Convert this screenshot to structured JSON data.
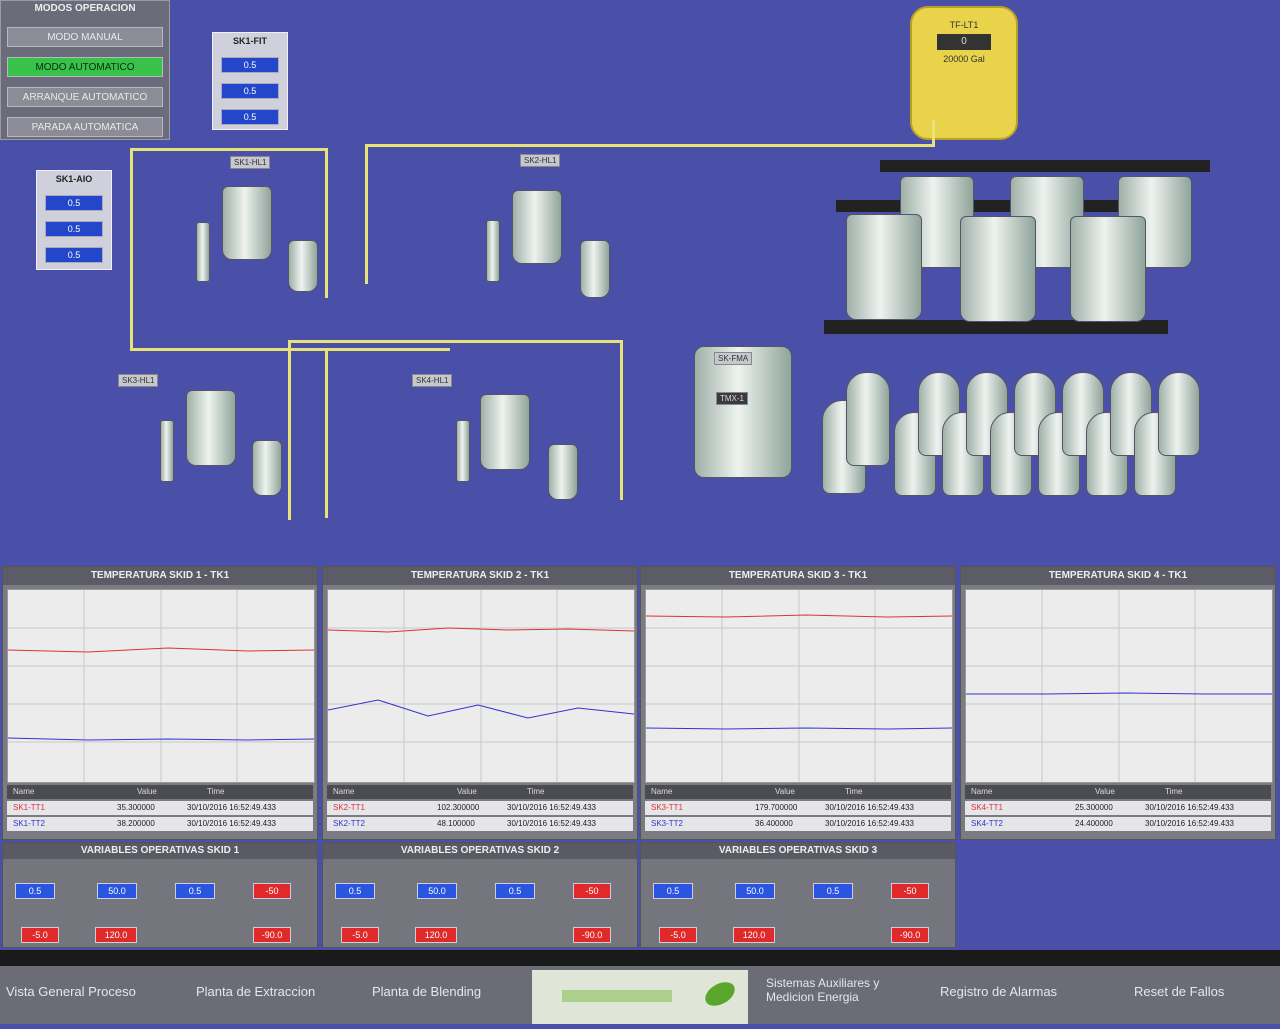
{
  "mode_panel": {
    "title": "MODOS OPERACION",
    "buttons": [
      {
        "label": "MODO MANUAL",
        "active": false
      },
      {
        "label": "MODO AUTOMATICO",
        "active": true
      },
      {
        "label": "ARRANQUE AUTOMATICO",
        "active": false
      },
      {
        "label": "PARADA AUTOMATICA",
        "active": false
      }
    ]
  },
  "mini_panel_top": {
    "title": "SK1-FIT",
    "values": [
      "0.5",
      "0.5",
      "0.5"
    ]
  },
  "mini_panel_left": {
    "title": "SK1-AIO",
    "values": [
      "0.5",
      "0.5",
      "0.5"
    ]
  },
  "yellow_tank": {
    "title": "TF-LT1",
    "value": "0",
    "capacity": "20000 Gal"
  },
  "vessel_labels": {
    "skid1": "SK1-HL1",
    "skid2": "SK2-HL1",
    "skid3": "SK3-HL1",
    "skid4": "SK4-HL1",
    "mix_tank": "SK-FMA",
    "mix_tank_val": "TMX-1"
  },
  "charts": [
    {
      "title": "TEMPERATURA SKID 1 - TK1",
      "rows": [
        {
          "name": "SK1-TT1",
          "value": "35.300000",
          "time": "30/10/2016 16:52:49.433"
        },
        {
          "name": "SK1-TT2",
          "value": "38.200000",
          "time": "30/10/2016 16:52:49.433"
        }
      ]
    },
    {
      "title": "TEMPERATURA SKID 2 - TK1",
      "rows": [
        {
          "name": "SK2-TT1",
          "value": "102.300000",
          "time": "30/10/2016 16:52:49.433"
        },
        {
          "name": "SK2-TT2",
          "value": "48.100000",
          "time": "30/10/2016 16:52:49.433"
        }
      ]
    },
    {
      "title": "TEMPERATURA SKID 3 - TK1",
      "rows": [
        {
          "name": "SK3-TT1",
          "value": "179.700000",
          "time": "30/10/2016 16:52:49.433"
        },
        {
          "name": "SK3-TT2",
          "value": "36.400000",
          "time": "30/10/2016 16:52:49.433"
        }
      ]
    },
    {
      "title": "TEMPERATURA SKID 4 - TK1",
      "rows": [
        {
          "name": "SK4-TT1",
          "value": "25.300000",
          "time": "30/10/2016 16:52:49.433"
        },
        {
          "name": "SK4-TT2",
          "value": "24.400000",
          "time": "30/10/2016 16:52:49.433"
        }
      ]
    }
  ],
  "legend_headers": [
    "Name",
    "Value",
    "Time"
  ],
  "var_panels": [
    {
      "title": "VARIABLES OPERATIVAS SKID 1",
      "blue": [
        "0.5",
        "50.0",
        "0.5"
      ],
      "red": [
        "-50",
        "-5.0",
        "120.0",
        "-90.0"
      ]
    },
    {
      "title": "VARIABLES OPERATIVAS SKID 2",
      "blue": [
        "0.5",
        "50.0",
        "0.5"
      ],
      "red": [
        "-50",
        "-5.0",
        "120.0",
        "-90.0"
      ]
    },
    {
      "title": "VARIABLES OPERATIVAS SKID 3",
      "blue": [
        "0.5",
        "50.0",
        "0.5"
      ],
      "red": [
        "-50",
        "-5.0",
        "120.0",
        "-90.0"
      ]
    }
  ],
  "nav": {
    "items": [
      "Vista General Proceso",
      "Planta de Extraccion",
      "Planta de Blending",
      "Sistemas Auxiliares y Medicion Energia",
      "Registro de Alarmas",
      "Reset de Fallos"
    ]
  }
}
